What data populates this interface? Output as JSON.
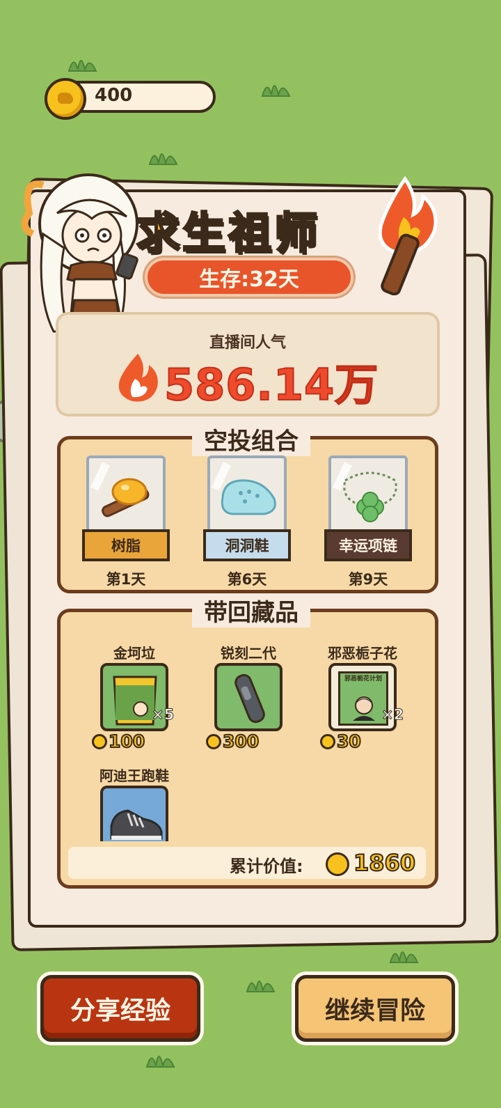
{
  "header": {
    "coins": "400"
  },
  "result": {
    "title": "求生祖师",
    "survival": "生存:32天",
    "popularity_label": "直播间人气",
    "popularity_value": "586.14万"
  },
  "airdrop": {
    "title": "空投组合",
    "items": [
      {
        "name": "树脂",
        "day": "第1天",
        "tag_color": "#e9a53a",
        "tag_text_color": "#3b2a1a"
      },
      {
        "name": "洞洞鞋",
        "day": "第6天",
        "tag_color": "#c5dcec",
        "tag_text_color": "#3b2a1a"
      },
      {
        "name": "幸运项链",
        "day": "第9天",
        "tag_color": "#5a3b32",
        "tag_text_color": "#fff4e0"
      }
    ]
  },
  "collection": {
    "title": "带回藏品",
    "items": [
      {
        "name": "金坷垃",
        "price": "100",
        "count": "×5",
        "icon": "fertilizer-bag-icon"
      },
      {
        "name": "锐刻二代",
        "price": "300",
        "count": "",
        "icon": "e-cigarette-icon"
      },
      {
        "name": "邪恶栀子花",
        "price": "30",
        "count": "×2",
        "icon": "photo-portrait-icon"
      },
      {
        "name": "阿迪王跑鞋",
        "price": "",
        "count": "",
        "icon": "sneakers-icon"
      }
    ],
    "portrait_caption": "邪恶栀花计划",
    "total_label": "累计价值:",
    "total_value": "1860"
  },
  "buttons": {
    "share": "分享经验",
    "continue": "继续冒险"
  },
  "colors": {
    "background": "#93c15f",
    "title_fill": "#f5b323",
    "survival_pill": "#e8552a",
    "popularity_text": "#ee4a2c",
    "share_button": "#b93512",
    "continue_button": "#f5c475"
  }
}
